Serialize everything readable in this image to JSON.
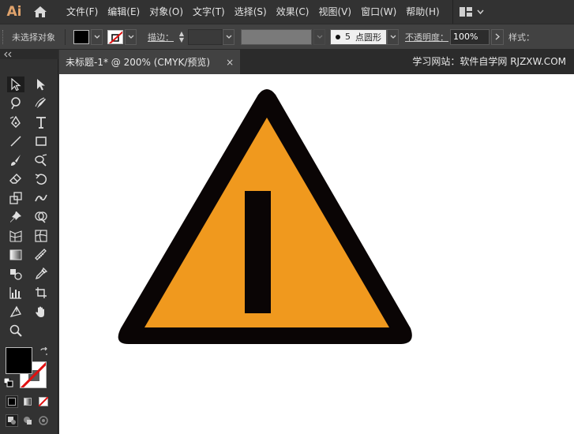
{
  "app": {
    "logo": "Ai"
  },
  "menu": {
    "items": [
      "文件(F)",
      "编辑(E)",
      "对象(O)",
      "文字(T)",
      "选择(S)",
      "效果(C)",
      "视图(V)",
      "窗口(W)",
      "帮助(H)"
    ]
  },
  "control": {
    "selection_label": "未选择对象",
    "stroke_label": "描边：",
    "brush_size": "5",
    "brush_label": "点圆形",
    "opacity_label": "不透明度：",
    "opacity_value": "100%",
    "style_label": "样式："
  },
  "tab": {
    "title": "未标题-1* @ 200% (CMYK/预览)",
    "close": "×"
  },
  "site": {
    "note": "学习网站：软件自学网 RJZXW.COM"
  },
  "icons": {
    "home": "home-icon",
    "workspace": "workspace-switcher-icon",
    "stroke_none": "stroke-none-icon"
  },
  "colors": {
    "fill": "#000000",
    "triangle_fill": "#f0991e",
    "triangle_stroke": "#0a0505",
    "canvas": "#ffffff"
  }
}
